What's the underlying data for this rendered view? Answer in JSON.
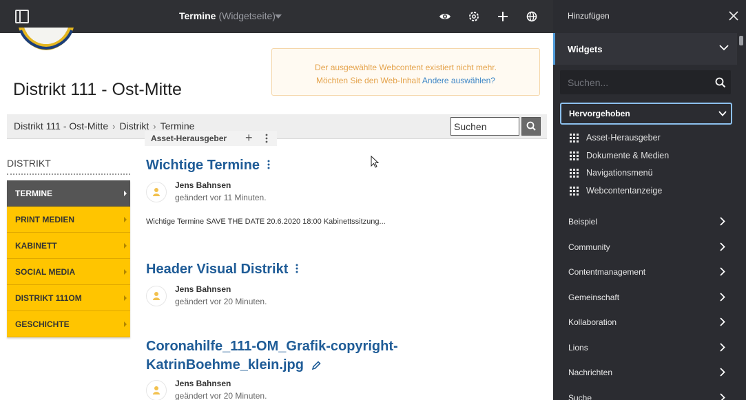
{
  "topbar": {
    "title": "Termine",
    "subtitle": "(Widgetseite)",
    "icons": [
      "panel-toggle-icon",
      "preview-eye-icon",
      "settings-gear-icon",
      "add-plus-icon",
      "globe-icon"
    ]
  },
  "notice": {
    "line1": "Der ausgewählte Webcontent existiert nicht mehr.",
    "line2_prefix": "Möchten Sie den Web-Inhalt",
    "line2_link": "Andere auswählen?"
  },
  "site": {
    "title": "Distrikt 111 - Ost-Mitte"
  },
  "breadcrumb": {
    "items": [
      "Distrikt 111 - Ost-Mitte",
      "Distrikt",
      "Termine"
    ],
    "separator": "›",
    "search_value": "Suchen"
  },
  "portlet": {
    "name": "Asset-Herausgeber"
  },
  "nav": {
    "heading": "DISTRIKT",
    "items": [
      {
        "label": "TERMINE",
        "active": true
      },
      {
        "label": "PRINT MEDIEN"
      },
      {
        "label": "KABINETT"
      },
      {
        "label": "SOCIAL MEDIA"
      },
      {
        "label": "DISTRIKT 111OM"
      },
      {
        "label": "GESCHICHTE"
      }
    ]
  },
  "articles": [
    {
      "title": "Wichtige Termine",
      "author": "Jens Bahnsen",
      "changed": "geändert vor 11 Minuten.",
      "summary": "Wichtige Termine SAVE THE DATE   20.6.2020 18:00 Kabinettssitzung..."
    },
    {
      "title": "Header Visual Distrikt",
      "author": "Jens Bahnsen",
      "changed": "geändert vor 20 Minuten."
    },
    {
      "title_line1": "Coronahilfe_111-OM_Grafik-copyright-",
      "title_line2": "KatrinBoehme_klein.jpg",
      "author": "Jens Bahnsen",
      "changed": "geändert vor 20 Minuten."
    }
  ],
  "sidebar": {
    "header": "Hinzufügen",
    "section": "Widgets",
    "search_placeholder": "Suchen...",
    "featured": "Hervorgehoben",
    "featured_widgets": [
      "Asset-Herausgeber",
      "Dokumente & Medien",
      "Navigationsmenü",
      "Webcontentanzeige"
    ],
    "categories": [
      "Beispiel",
      "Community",
      "Contentmanagement",
      "Gemeinschaft",
      "Kollaboration",
      "Lions",
      "Nachrichten",
      "Suche"
    ]
  },
  "colors": {
    "topbar": "#2f3034",
    "sidebar": "#2b2c31",
    "nav_yellow": "#ffc500",
    "nav_active": "#555555",
    "title_blue": "#1f5c97",
    "accent_blue": "#4f9bd9"
  }
}
